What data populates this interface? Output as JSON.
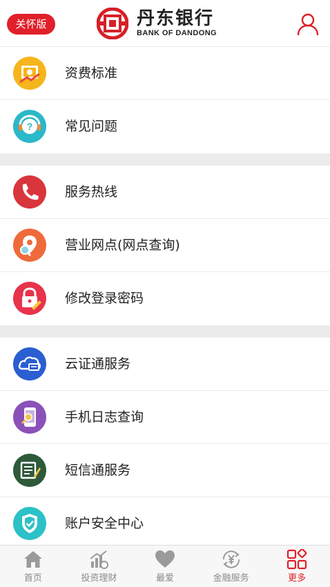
{
  "header": {
    "care_badge": "关怀版",
    "logo_cn": "丹东银行",
    "logo_en": "BANK OF DANDONG",
    "accent_color": "#e0202a"
  },
  "menu_groups": [
    {
      "items": [
        {
          "label": "资费标准",
          "icon": "fee-standard-icon"
        },
        {
          "label": "常见问题",
          "icon": "faq-icon"
        }
      ]
    },
    {
      "items": [
        {
          "label": "服务热线",
          "icon": "hotline-phone-icon"
        },
        {
          "label": "营业网点(网点查询)",
          "icon": "branch-locator-icon"
        },
        {
          "label": "修改登录密码",
          "icon": "change-password-icon"
        }
      ]
    },
    {
      "items": [
        {
          "label": "云证通服务",
          "icon": "cloud-certificate-icon"
        },
        {
          "label": "手机日志查询",
          "icon": "phone-log-icon"
        },
        {
          "label": "短信通服务",
          "icon": "sms-service-icon"
        },
        {
          "label": "账户安全中心",
          "icon": "account-security-icon"
        }
      ]
    }
  ],
  "tabbar": {
    "tabs": [
      {
        "label": "首页",
        "icon": "home-icon",
        "active": false
      },
      {
        "label": "投资理财",
        "icon": "investment-icon",
        "active": false
      },
      {
        "label": "最爱",
        "icon": "heart-icon",
        "active": false
      },
      {
        "label": "金融服务",
        "icon": "yuan-service-icon",
        "active": false
      },
      {
        "label": "更多",
        "icon": "more-grid-icon",
        "active": true
      }
    ]
  }
}
